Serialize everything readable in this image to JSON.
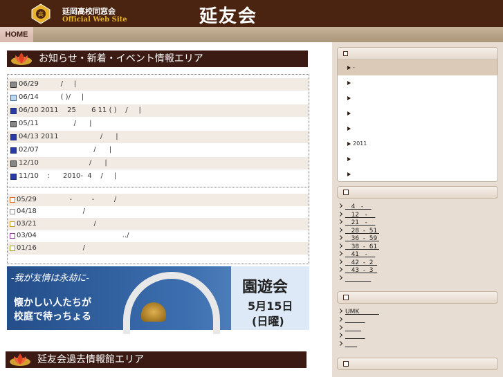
{
  "header": {
    "school_name": "延岡高校同窓会",
    "official": "Official Web Site",
    "site_title": "延友会"
  },
  "nav": {
    "home": "HOME"
  },
  "news": {
    "heading": "お知らせ・新着・イベント情報エリア",
    "items": [
      {
        "icon": "doc",
        "text": "06/29          /     |"
      },
      {
        "icon": "cam",
        "text": "06/14          ( )/     |"
      },
      {
        "icon": "blue",
        "text": "06/10 2011    25       6 11 ( )    /     |"
      },
      {
        "icon": "doc",
        "text": "05/11                /      |"
      },
      {
        "icon": "blue",
        "text": "04/13 2011                   /      |"
      },
      {
        "icon": "blue",
        "text": "02/07                         /      |"
      },
      {
        "icon": "doc",
        "text": "12/10                       /      |"
      },
      {
        "icon": "blue",
        "text": "11/10    :      2010-  4    /     |"
      }
    ],
    "older": [
      {
        "icon": "orange",
        "text": "05/29               -         -         /"
      },
      {
        "icon": "gray",
        "text": "04/18                     /"
      },
      {
        "icon": "yellow",
        "text": "03/21                          /"
      },
      {
        "icon": "purple",
        "text": "03/04                                       ../"
      },
      {
        "icon": "olive",
        "text": "01/16                     /"
      }
    ]
  },
  "banner": {
    "motto": "-我が友情は永劫に-",
    "line1": "懐かしい人たちが",
    "line2": "校庭で待っちょる",
    "event": "園遊会",
    "date": "5月15日",
    "day": "(日曜)"
  },
  "past": {
    "heading": "延友会過去情報館エリア"
  },
  "sidebar": {
    "menu": [
      {
        "label": "-",
        "active": true
      },
      {
        "label": ""
      },
      {
        "label": ""
      },
      {
        "label": ""
      },
      {
        "label": ""
      },
      {
        "label": "2011"
      },
      {
        "label": ""
      },
      {
        "label": ""
      }
    ],
    "class_links": [
      "   4   -    ",
      "   12   -    ",
      "   21   -    ",
      "   28  -  51 ",
      "   36  -  59 ",
      "   38  -  61 ",
      "   41   -    ",
      "   42  -  2  ",
      "   43  -  3  ",
      "             "
    ],
    "other_links": [
      "UMK          ",
      "          ",
      "        ",
      "          ",
      "      "
    ]
  }
}
